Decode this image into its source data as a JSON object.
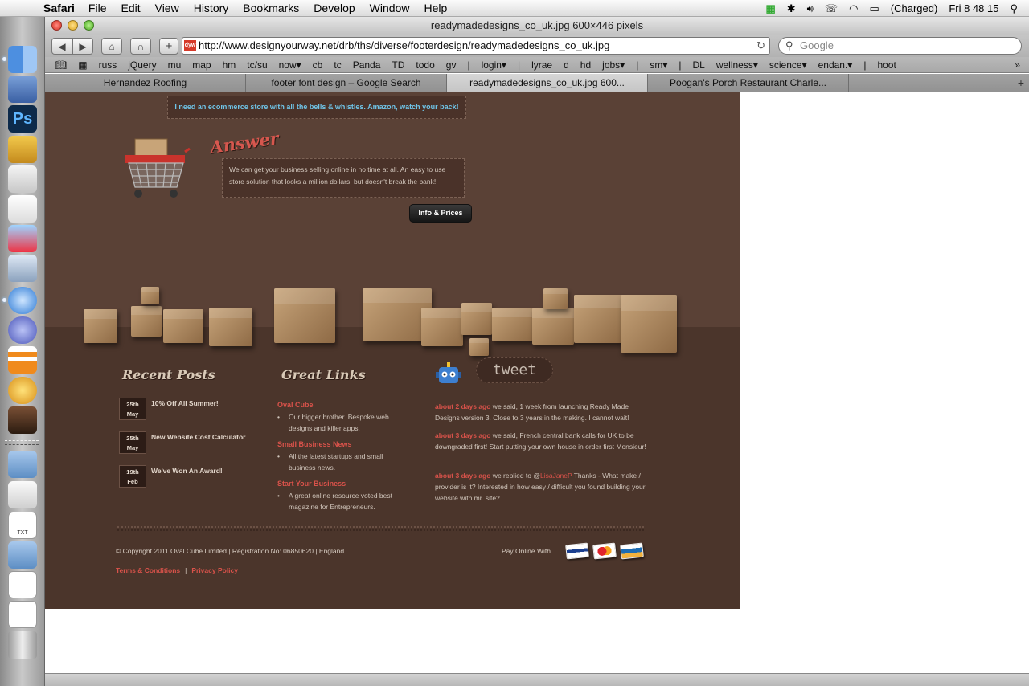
{
  "menubar": {
    "app_name": "Safari",
    "items": [
      "File",
      "Edit",
      "View",
      "History",
      "Bookmarks",
      "Develop",
      "Window",
      "Help"
    ],
    "battery": "(Charged)",
    "clock": "Fri 8 48 15"
  },
  "window": {
    "title": "readymadedesigns_co_uk.jpg 600×446 pixels"
  },
  "toolbar": {
    "url": "http://www.designyourway.net/drb/ths/diverse/footerdesign/readymadedesigns_co_uk.jpg",
    "search_placeholder": "Google",
    "favicon_text": "dyw"
  },
  "bookmarks": [
    "russ",
    "jQuery",
    "mu",
    "map",
    "hm",
    "tc/su",
    "now▾",
    "cb",
    "tc",
    "Panda",
    "TD",
    "todo",
    "gv",
    "|",
    "login▾",
    "|",
    "lyrae",
    "d",
    "hd",
    "jobs▾",
    "|",
    "sm▾",
    "|",
    "DL",
    "wellness▾",
    "science▾",
    "endan.▾",
    "|",
    "hoot"
  ],
  "tabs": [
    {
      "label": "Hernandez Roofing",
      "active": false
    },
    {
      "label": "footer font design – Google Search",
      "active": false
    },
    {
      "label": "readymadedesigns_co_uk.jpg 600...",
      "active": true
    },
    {
      "label": "Poogan's Porch Restaurant Charle...",
      "active": false
    }
  ],
  "site": {
    "banner_text": "I need an ecommerce store with all the bells & whistles. Amazon, watch your back!",
    "answer_heading": "Answer",
    "answer_text": "We can get your business selling online in no time at all. An easy to use store solution that looks a million dollars, but doesn't break the bank!",
    "info_button": "Info & Prices",
    "recent_posts": {
      "heading": "Recent Posts",
      "posts": [
        {
          "day": "25th",
          "month": "May",
          "title": "10% Off All Summer!"
        },
        {
          "day": "25th",
          "month": "May",
          "title": "New Website Cost Calculator"
        },
        {
          "day": "19th",
          "month": "Feb",
          "title": "We've Won An Award!"
        }
      ]
    },
    "great_links": {
      "heading": "Great Links",
      "links": [
        {
          "title": "Oval Cube",
          "desc": "Our bigger brother. Bespoke web designs and killer apps."
        },
        {
          "title": "Small Business News",
          "desc": "All the latest startups and small business news."
        },
        {
          "title": "Start Your Business",
          "desc": "A great online resource voted best magazine for Entrepreneurs."
        }
      ]
    },
    "tweets": {
      "logo": "tweet",
      "items": [
        {
          "ago": "about 2 days ago",
          "text": " we said, 1 week from launching Ready Made Designs version 3. Close to 3 years in the making. I cannot wait!"
        },
        {
          "ago": "about 3 days ago",
          "text": " we said, French central bank calls for UK to be downgraded first! Start putting your own house in order first Monsieur!"
        },
        {
          "ago": "about 3 days ago",
          "text_before": " we replied to @",
          "handle": "LisaJaneP",
          "text_after": " Thanks - What make / provider is it? Interested in how easy / difficult you found building your website with mr. site?"
        }
      ]
    },
    "copyright": "© Copyright 2011 Oval Cube Limited | Registration No: 06850620 | England",
    "terms": "Terms & Conditions",
    "privacy": "Privacy Policy",
    "separator": "|",
    "pay_online": "Pay Online With"
  }
}
